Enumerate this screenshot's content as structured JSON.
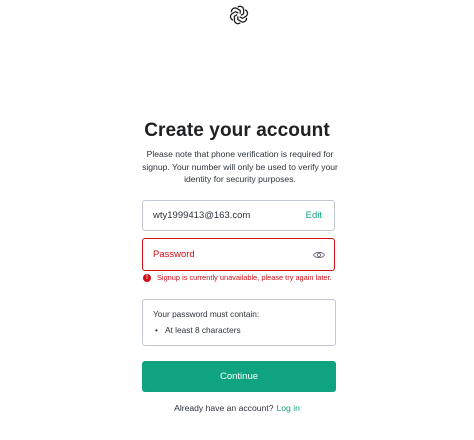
{
  "header": {
    "logo_icon": "openai-logo-icon"
  },
  "main": {
    "title": "Create your account",
    "subtitle": "Please note that phone verification is required for signup. Your number will only be used to verify your identity for security purposes."
  },
  "email": {
    "value": "wty1999413@163.com",
    "edit_label": "Edit"
  },
  "password": {
    "placeholder": "Password",
    "visibility_icon": "eye-icon"
  },
  "error": {
    "icon": "error-icon",
    "icon_glyph": "!",
    "message": "Signup is currently unavailable, please try again later."
  },
  "requirements": {
    "title": "Your password must contain:",
    "items": [
      {
        "bullet": "•",
        "text": "At least 8 characters"
      }
    ]
  },
  "actions": {
    "continue_label": "Continue"
  },
  "footer": {
    "prompt": "Already have an account?",
    "login_label": "Log in"
  },
  "colors": {
    "accent": "#10a37f",
    "error": "#d00e17",
    "border": "#c2c8d0",
    "text": "#2d333a"
  }
}
